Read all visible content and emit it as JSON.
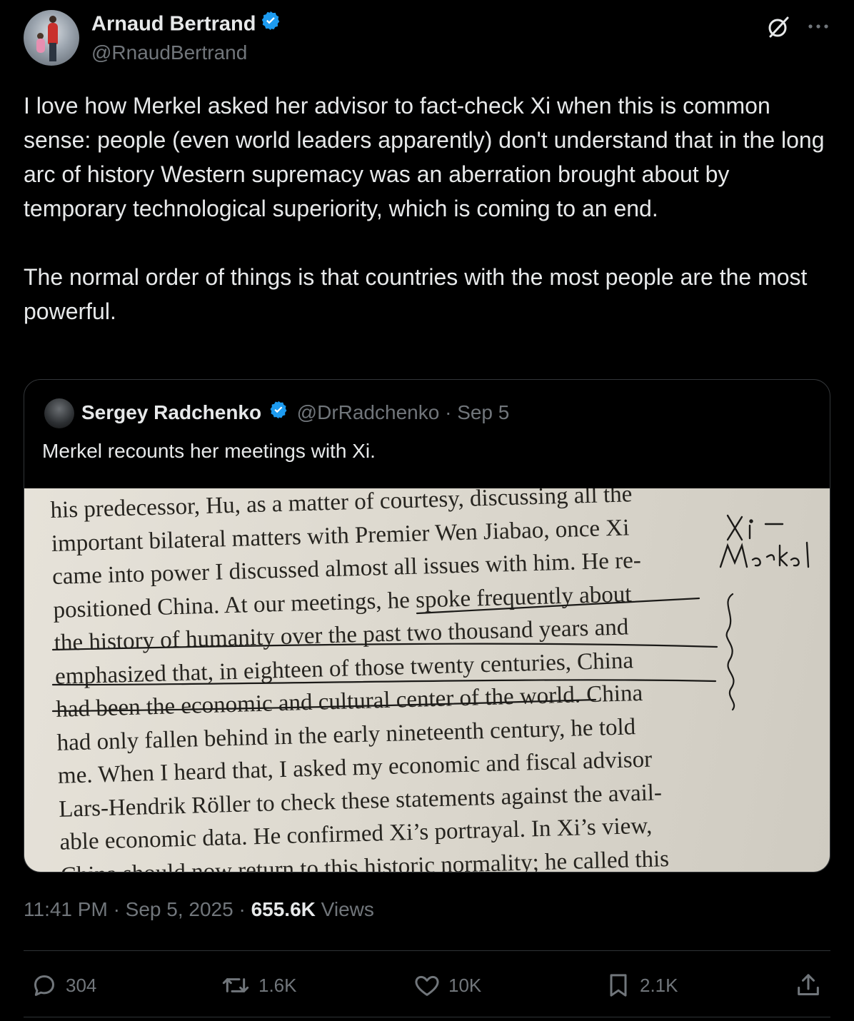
{
  "author": {
    "name": "Arnaud Bertrand",
    "handle": "@RnaudBertrand"
  },
  "tweet": {
    "text": "I love how Merkel asked her advisor to fact-check Xi when this is common sense: people (even world leaders apparently) don't understand that in the long arc of history Western supremacy was an aberration brought about by temporary technological superiority, which is coming to an end.\n\nThe normal order of things is that countries with the most people are the most powerful."
  },
  "quoted": {
    "name": "Sergey Radchenko",
    "handle": "@DrRadchenko",
    "date": "Sep 5",
    "separator": "·",
    "text": "Merkel recounts her meetings with Xi.",
    "book_lines": [
      "his predecessor, Hu, as a matter of courtesy, discussing all the",
      "important bilateral matters with Premier Wen Jiabao, once Xi",
      "came into power I discussed almost all issues with him. He re-",
      "positioned China. At our meetings, he spoke frequently about",
      "the history of humanity over the past two thousand years and",
      "emphasized that, in eighteen of those twenty centuries, China",
      "had been the economic and cultural center of the world. China",
      "had only fallen behind in the early nineteenth century, he told",
      "me. When I heard that, I asked my economic and fiscal advisor",
      "Lars-Hendrik Röller to check these statements against the avail-",
      "able economic data. He confirmed Xi’s portrayal. In Xi’s view,",
      "China should now return to this historic normality; he called this"
    ],
    "handwritten_note": "Xi — Merkel"
  },
  "meta": {
    "time": "11:41 PM",
    "separator": "·",
    "date": "Sep 5, 2025",
    "views_count": "655.6K",
    "views_label": "Views"
  },
  "actions": {
    "replies": "304",
    "reposts": "1.6K",
    "likes": "10K",
    "bookmarks": "2.1K"
  },
  "colors": {
    "background": "#000000",
    "text": "#e7e9ea",
    "muted": "#71767b",
    "verified": "#1d9bf0",
    "border": "#333639"
  },
  "icons": [
    "verified-badge-icon",
    "grok-icon",
    "more-icon",
    "reply-icon",
    "repost-icon",
    "like-icon",
    "bookmark-icon",
    "share-icon"
  ]
}
